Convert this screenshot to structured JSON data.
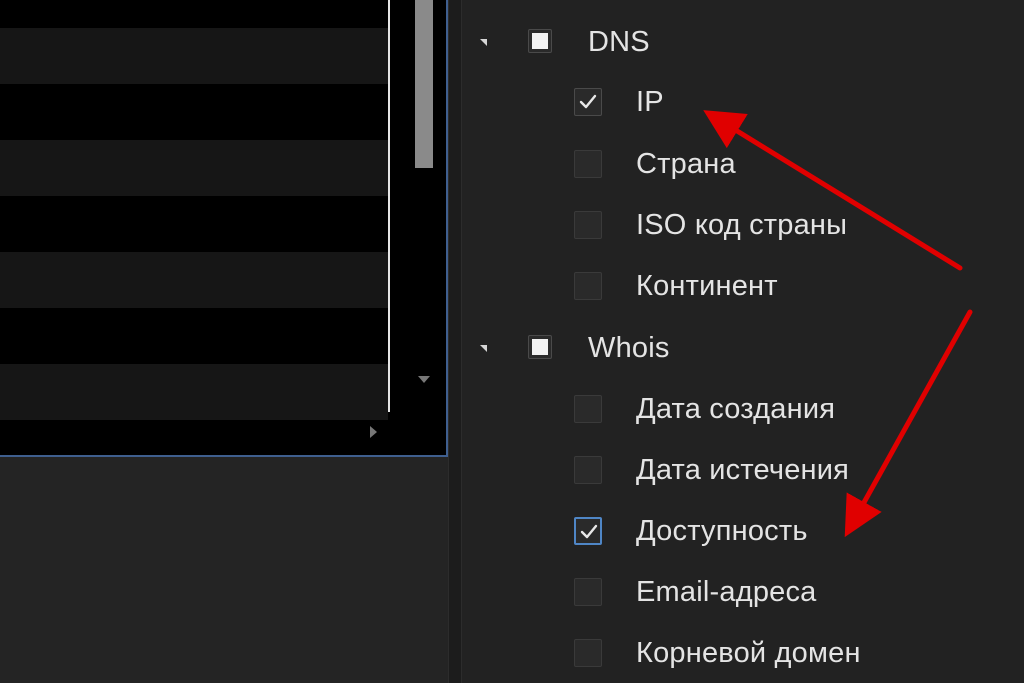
{
  "tree": {
    "groups": [
      {
        "label": "DNS",
        "expanded": true,
        "items": [
          {
            "label": "IP",
            "checked": true
          },
          {
            "label": "Страна",
            "checked": false
          },
          {
            "label": "ISO код страны",
            "checked": false
          },
          {
            "label": "Континент",
            "checked": false
          }
        ]
      },
      {
        "label": "Whois",
        "expanded": true,
        "items": [
          {
            "label": "Дата создания",
            "checked": false
          },
          {
            "label": "Дата истечения",
            "checked": false
          },
          {
            "label": "Доступность",
            "checked": true,
            "focused": true
          },
          {
            "label": "Email-адреса",
            "checked": false
          },
          {
            "label": "Корневой домен",
            "checked": false
          }
        ]
      }
    ]
  },
  "icons": {
    "expander": "triangle-down-icon",
    "check": "checkmark-icon",
    "scroll_down": "scroll-down-arrow-icon",
    "scroll_right": "scroll-right-arrow-icon"
  },
  "colors": {
    "background": "#222222",
    "grid_background": "#000000",
    "focus_border": "#4f86c6",
    "annotation_arrow": "#e00000",
    "text": "#e4e4e4"
  }
}
